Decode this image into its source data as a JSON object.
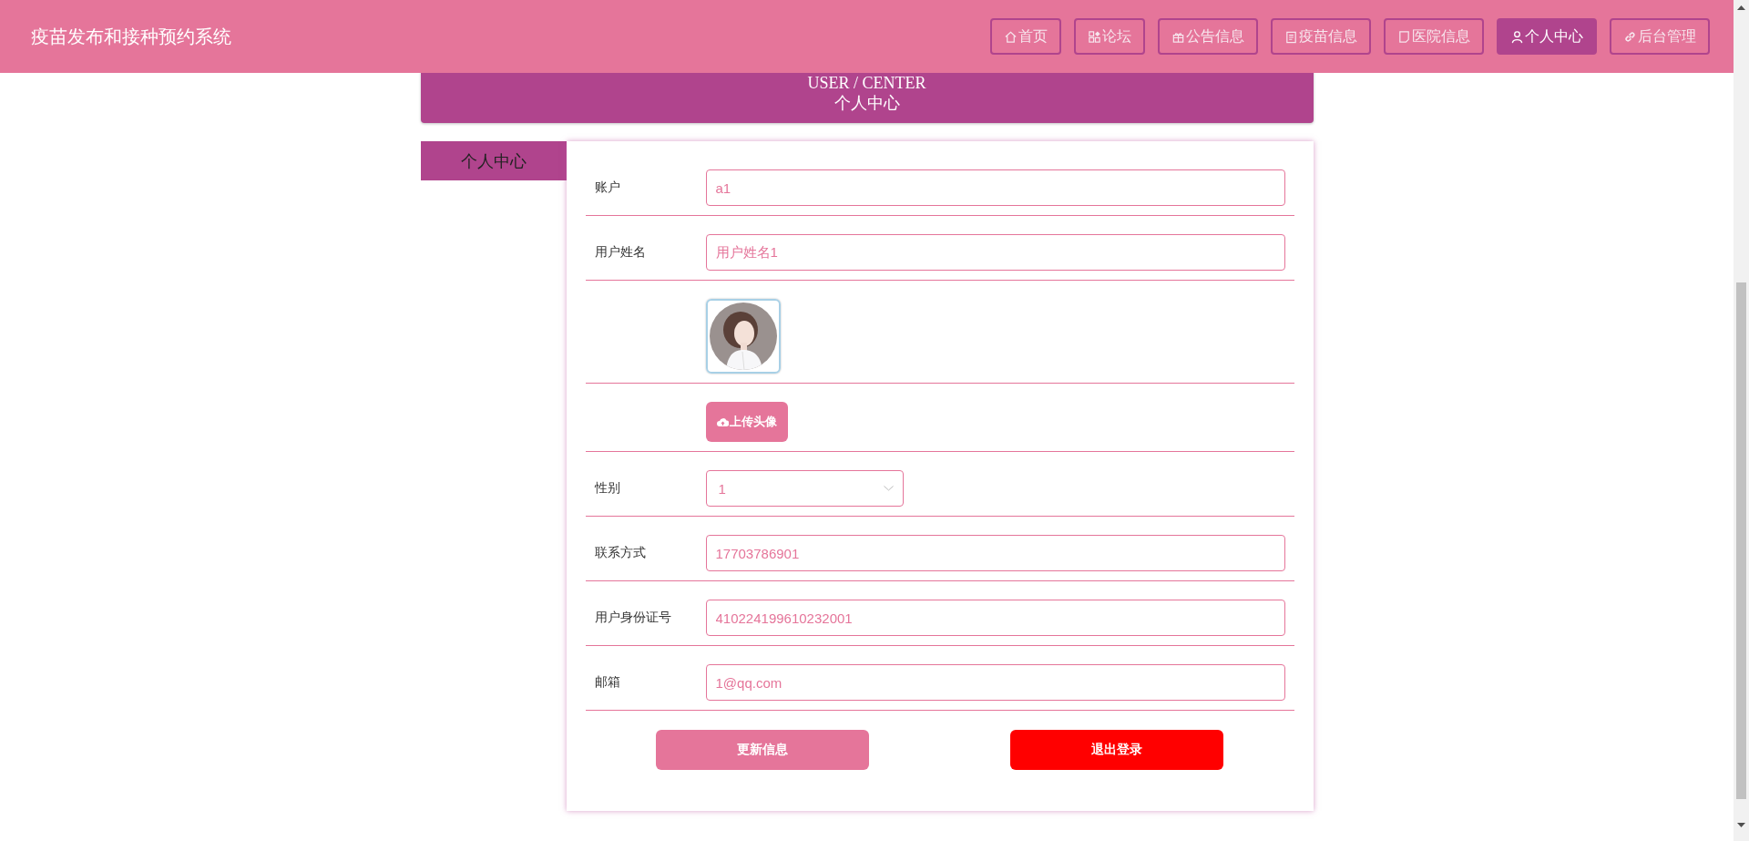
{
  "header": {
    "title": "疫苗发布和接种预约系统",
    "nav": [
      {
        "label": "首页",
        "selected": false
      },
      {
        "label": "论坛",
        "selected": false
      },
      {
        "label": "公告信息",
        "selected": false
      },
      {
        "label": "疫苗信息",
        "selected": false
      },
      {
        "label": "医院信息",
        "selected": false
      },
      {
        "label": "个人中心",
        "selected": true
      },
      {
        "label": "后台管理",
        "selected": false
      }
    ]
  },
  "banner": {
    "subtitle": "USER / CENTER",
    "title": "个人中心"
  },
  "sidebar": {
    "items": [
      {
        "label": "个人中心",
        "selected": true
      }
    ]
  },
  "form": {
    "rows": [
      {
        "kind": "text",
        "label": "账户",
        "value": "a1"
      },
      {
        "kind": "text",
        "label": "用户姓名",
        "value": "用户姓名1"
      },
      {
        "kind": "avatar"
      },
      {
        "kind": "upload",
        "button": "上传头像"
      },
      {
        "kind": "select",
        "label": "性别",
        "value": "1"
      },
      {
        "kind": "text",
        "label": "联系方式",
        "value": "17703786901"
      },
      {
        "kind": "text",
        "label": "用户身份证号",
        "value": "410224199610232001"
      },
      {
        "kind": "text",
        "label": "邮箱",
        "value": "1@qq.com"
      }
    ],
    "buttons": [
      {
        "kind": "primary",
        "label": "更新信息"
      },
      {
        "kind": "danger",
        "label": "退出登录"
      }
    ]
  }
}
